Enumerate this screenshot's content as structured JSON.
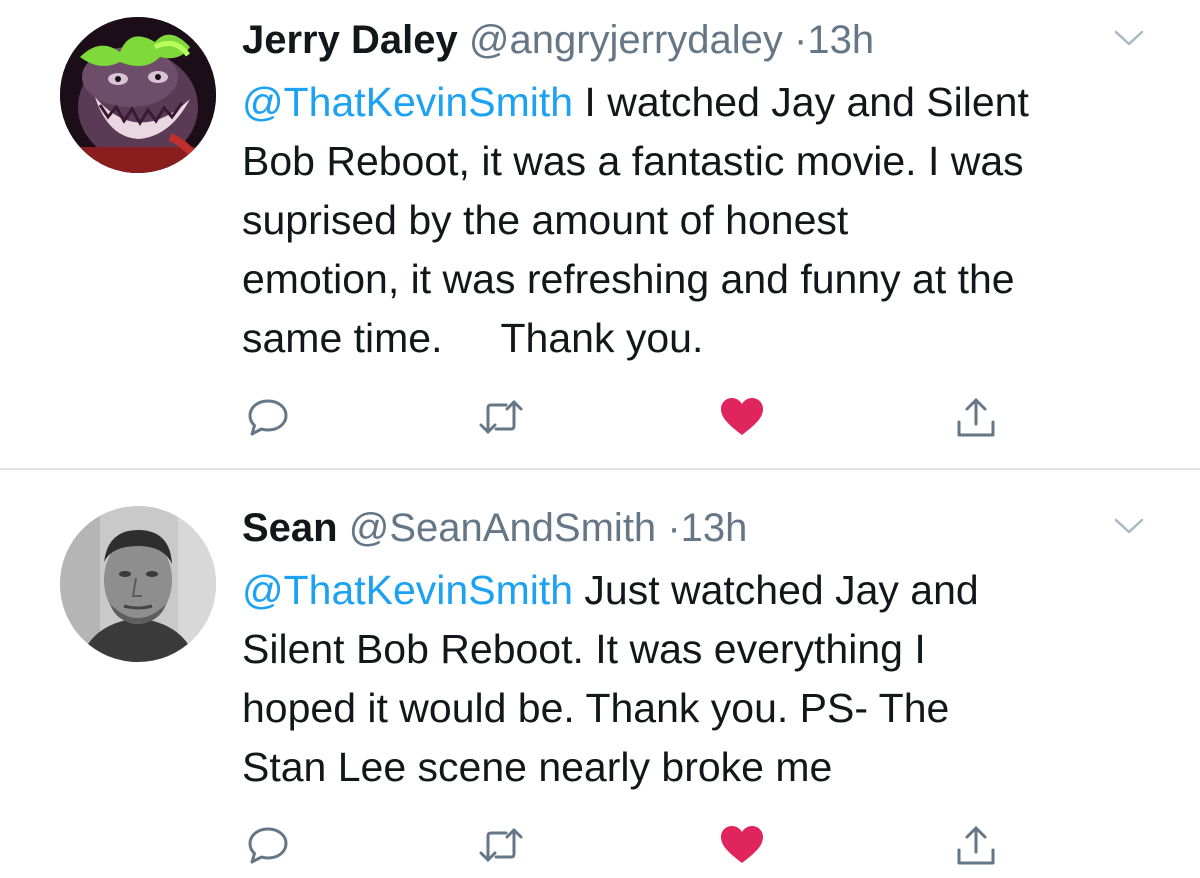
{
  "tweets": [
    {
      "name": "Jerry Daley",
      "handle": "@angryjerrydaley",
      "separator": "·",
      "time": "13h",
      "mention": "@ThatKevinSmith",
      "text_lines": [
        " I watched Jay and Silent",
        "Bob Reboot, it was a fantastic movie. I was",
        "suprised by the amount of honest",
        "emotion, it was refreshing and funny at the",
        "same time.",
        "Thank you."
      ],
      "liked": true,
      "avatar": "joker-art-avatar"
    },
    {
      "name": "Sean",
      "handle": "@SeanAndSmith",
      "separator": "·",
      "time": "13h",
      "mention": "@ThatKevinSmith",
      "text_lines": [
        " Just watched Jay and",
        "Silent Bob Reboot. It was everything I",
        "hoped it would be. Thank you. PS- The",
        "Stan Lee scene nearly broke me"
      ],
      "liked": true,
      "avatar": "grayscale-photo-avatar"
    }
  ],
  "icons": {
    "reply": "reply-icon",
    "retweet": "retweet-icon",
    "like": "heart-icon",
    "share": "share-icon",
    "menu": "chevron-down-icon"
  },
  "colors": {
    "mention": "#1da1f2",
    "secondary_text": "#657786",
    "like_active": "#e0245e",
    "icon_gray": "#657786",
    "divider": "#dfe3e7"
  }
}
